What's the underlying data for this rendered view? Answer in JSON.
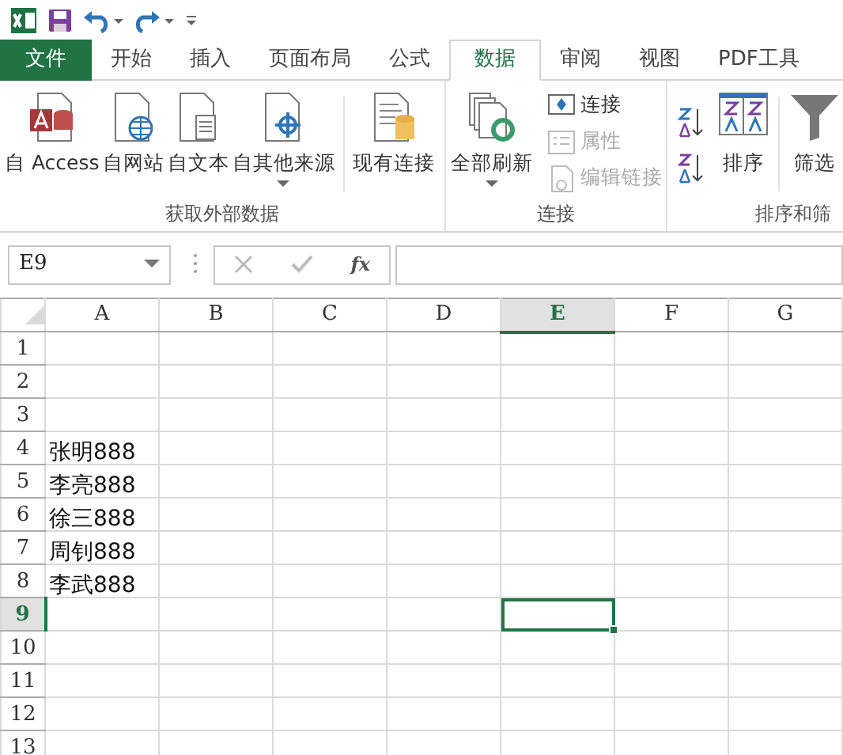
{
  "tabs": [
    {
      "label": "文件",
      "kind": "file",
      "selected": false
    },
    {
      "label": "开始",
      "kind": "tab",
      "selected": false
    },
    {
      "label": "插入",
      "kind": "tab",
      "selected": false
    },
    {
      "label": "页面布局",
      "kind": "tab",
      "selected": false
    },
    {
      "label": "公式",
      "kind": "tab",
      "selected": false
    },
    {
      "label": "数据",
      "kind": "tab",
      "selected": true
    },
    {
      "label": "审阅",
      "kind": "tab",
      "selected": false
    },
    {
      "label": "视图",
      "kind": "tab",
      "selected": false
    },
    {
      "label": "PDF工具",
      "kind": "tab",
      "selected": false
    }
  ],
  "ribbon_groups": [
    {
      "label": "获取外部数据",
      "buttons": [
        {
          "label": "自 Access",
          "kind": "large"
        },
        {
          "label": "自网站",
          "kind": "large"
        },
        {
          "label": "自文本",
          "kind": "large"
        },
        {
          "label": "自其他来源",
          "kind": "large",
          "dropdown": true
        },
        {
          "label": "现有连接",
          "kind": "large"
        }
      ]
    },
    {
      "label": "连接",
      "buttons": [
        {
          "label": "全部刷新",
          "kind": "large",
          "dropdown": true
        },
        {
          "label": "连接",
          "kind": "small",
          "disabled": false
        },
        {
          "label": "属性",
          "kind": "small",
          "disabled": true
        },
        {
          "label": "编辑链接",
          "kind": "small",
          "disabled": true
        }
      ]
    },
    {
      "label": "排序和筛",
      "buttons": [
        {
          "kind": "icon"
        },
        {
          "kind": "icon"
        },
        {
          "label": "排序",
          "kind": "large"
        },
        {
          "label": "筛选",
          "kind": "large"
        }
      ]
    }
  ],
  "name_box": "E9",
  "function_label": "fx",
  "columns": [
    {
      "label": "A",
      "selected": false
    },
    {
      "label": "B",
      "selected": false
    },
    {
      "label": "C",
      "selected": false
    },
    {
      "label": "D",
      "selected": false
    },
    {
      "label": "E",
      "selected": true
    },
    {
      "label": "F",
      "selected": false
    },
    {
      "label": "G",
      "selected": false
    }
  ],
  "rows": [
    {
      "label": "1",
      "selected": false
    },
    {
      "label": "2",
      "selected": false
    },
    {
      "label": "3",
      "selected": false
    },
    {
      "label": "4",
      "selected": false,
      "a": "张明888"
    },
    {
      "label": "5",
      "selected": false,
      "a": "李亮888"
    },
    {
      "label": "6",
      "selected": false,
      "a": "徐三888"
    },
    {
      "label": "7",
      "selected": false,
      "a": "周钊888"
    },
    {
      "label": "8",
      "selected": false,
      "a": "李武888"
    },
    {
      "label": "9",
      "selected": true
    },
    {
      "label": "10",
      "selected": false
    },
    {
      "label": "11",
      "selected": false
    },
    {
      "label": "12",
      "selected": false
    },
    {
      "label": "13",
      "selected": false
    }
  ]
}
